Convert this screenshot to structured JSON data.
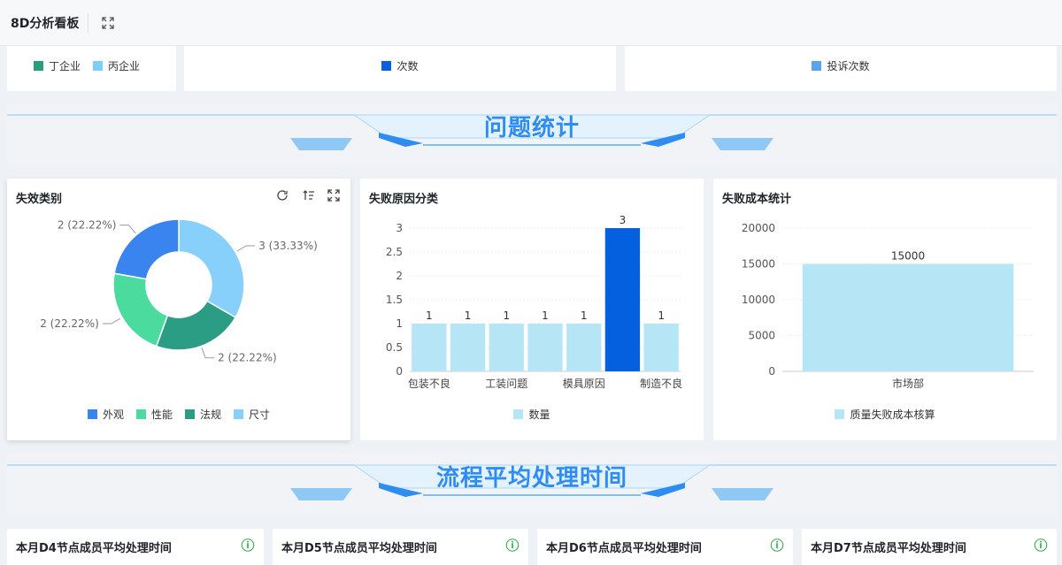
{
  "header": {
    "title": "8D分析看板"
  },
  "top_row": {
    "card1_legend": [
      {
        "label": "丁企业",
        "color": "#2a9d7f"
      },
      {
        "label": "丙企业",
        "color": "#7ccff5"
      }
    ],
    "card2_legend": {
      "label": "次数",
      "color": "#0b5ee0"
    },
    "card3_legend": {
      "label": "投诉次数",
      "color": "#5ba4e6"
    }
  },
  "banner1": {
    "title": "问题统计"
  },
  "banner2": {
    "title": "流程平均处理时间"
  },
  "failure_type": {
    "title": "失效类别",
    "chart_data": {
      "type": "pie",
      "labels": [
        "外观",
        "性能",
        "法规",
        "尺寸"
      ],
      "values": [
        2,
        2,
        2,
        3
      ],
      "colors": [
        "#3a84f0",
        "#4cdb9f",
        "#2a9d84",
        "#86d0fb"
      ],
      "data_labels": [
        "2 (22.22%)",
        "2 (22.22%)",
        "2 (22.22%)",
        "3 (33.33%)"
      ]
    }
  },
  "failure_reason": {
    "title": "失败原因分类",
    "chart_data": {
      "type": "bar",
      "categories": [
        "包装不良",
        "",
        "工装问题",
        "",
        "模具原因",
        "",
        "制造不良"
      ],
      "values": [
        1,
        1,
        1,
        1,
        1,
        3,
        1
      ],
      "highlight_index": 5,
      "y_ticks": [
        "0",
        "0.5",
        "1",
        "1.5",
        "2",
        "2.5",
        "3"
      ],
      "ylim": [
        0,
        3
      ],
      "legend": "数量",
      "color": "#b6e6f5",
      "highlight_color": "#0560e0"
    }
  },
  "failure_cost": {
    "title": "失败成本统计",
    "chart_data": {
      "type": "bar",
      "categories": [
        "市场部"
      ],
      "values": [
        15000
      ],
      "y_ticks": [
        "0",
        "5000",
        "10000",
        "15000",
        "20000"
      ],
      "ylim": [
        0,
        20000
      ],
      "legend": "质量失败成本核算",
      "color": "#b6e6f5"
    }
  },
  "bottom_cards": [
    {
      "title": "本月D4节点成员平均处理时间"
    },
    {
      "title": "本月D5节点成员平均处理时间"
    },
    {
      "title": "本月D6节点成员平均处理时间"
    },
    {
      "title": "本月D7节点成员平均处理时间"
    }
  ],
  "icons": {
    "info": "ⓘ"
  }
}
